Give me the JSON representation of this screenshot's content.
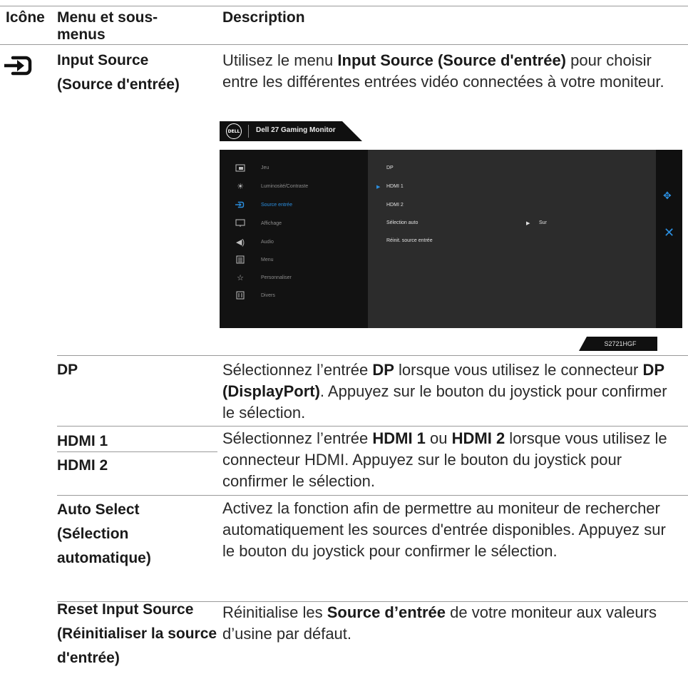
{
  "headers": {
    "icon": "Icône",
    "menu": "Menu et sous-menus",
    "description": "Description"
  },
  "input_source": {
    "icon": "input-source-icon",
    "name": "Input Source (Source d'entrée)",
    "desc_prefix": "Utilisez le menu ",
    "desc_bold": "Input Source (Source d'entrée)",
    "desc_suffix": " pour choisir entre les différentes entrées vidéo connectées à votre moniteur."
  },
  "osd": {
    "brand": "DELL",
    "title": "Dell 27 Gaming Monitor",
    "menu_items": [
      {
        "icon": "game-icon",
        "label": "Jeu"
      },
      {
        "icon": "brightness-icon",
        "label": "Luminosité/Contraste"
      },
      {
        "icon": "input-source-icon",
        "label": "Source entrée"
      },
      {
        "icon": "display-icon",
        "label": "Affichage"
      },
      {
        "icon": "audio-icon",
        "label": "Audio"
      },
      {
        "icon": "menu-icon",
        "label": "Menu"
      },
      {
        "icon": "star-icon",
        "label": "Personnaliser"
      },
      {
        "icon": "others-icon",
        "label": "Divers"
      }
    ],
    "active_menu": "Source entrée",
    "sub_items": [
      "DP",
      "HDMI 1",
      "HDMI 2",
      "Sélection auto",
      "Réinit. source entrée"
    ],
    "selected_sub": "HDMI 1",
    "auto_select_value": "Sur",
    "model": "S2721HGF",
    "accent": "#2b8fe0"
  },
  "rows": [
    {
      "name": "DP",
      "desc_1": "Sélectionnez l’entrée ",
      "bold_1": "DP",
      "desc_2": " lorsque vous utilisez le connecteur ",
      "bold_2": "DP (DisplayPort)",
      "desc_3": ". Appuyez sur le bouton du joystick pour confirmer le sélection."
    },
    {
      "name_a": "HDMI 1",
      "name_b": "HDMI 2",
      "desc_1": "Sélectionnez l’entrée ",
      "bold_1": "HDMI 1",
      "desc_2": " ou ",
      "bold_2": "HDMI 2",
      "desc_3": " lorsque vous utilisez le connecteur HDMI. Appuyez sur le bouton du joystick pour confirmer le sélection."
    },
    {
      "name": "Auto Select (Sélection automatique)",
      "desc": "Activez la fonction afin de permettre au moniteur de rechercher automatiquement les sources d'entrée disponibles. Appuyez sur le bouton du joystick pour confirmer le sélection."
    },
    {
      "name": "Reset Input Source (Réinitialiser la source d'entrée)",
      "desc_1": "Réinitialise les ",
      "bold_1": "Source d’entrée",
      "desc_2": " de votre moniteur aux valeurs d’usine par défaut."
    }
  ]
}
